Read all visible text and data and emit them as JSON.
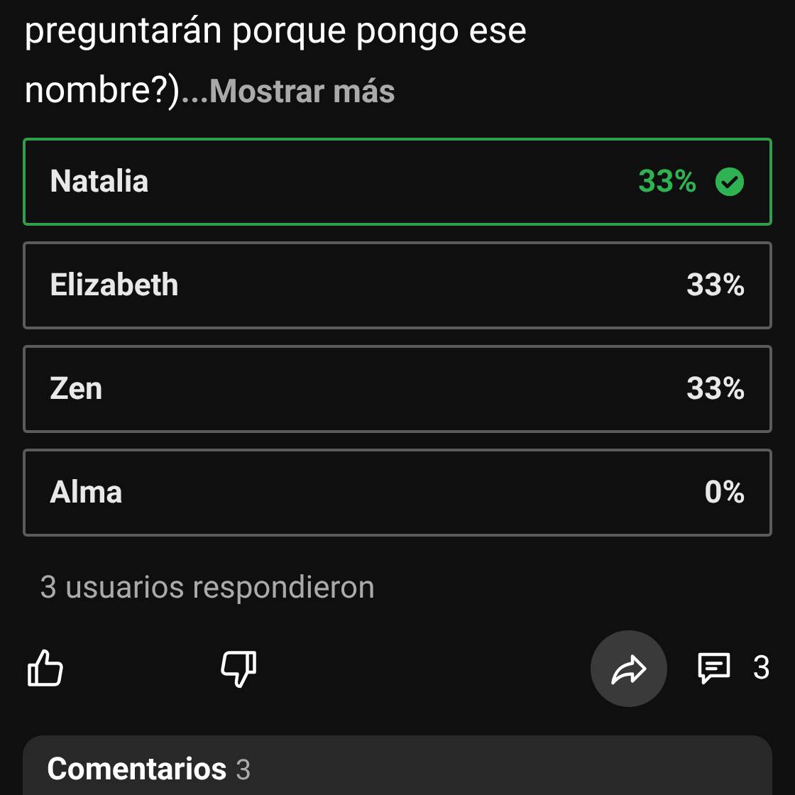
{
  "post": {
    "text_lines": [
      "preguntarán porque pongo ese",
      "nombre?)"
    ],
    "show_more": "...Mostrar más"
  },
  "poll": {
    "options": [
      {
        "label": "Natalia",
        "percent": "33%",
        "selected": true
      },
      {
        "label": "Elizabeth",
        "percent": "33%",
        "selected": false
      },
      {
        "label": "Zen",
        "percent": "33%",
        "selected": false
      },
      {
        "label": "Alma",
        "percent": "0%",
        "selected": false
      }
    ],
    "responses": "3 usuarios respondieron"
  },
  "actions": {
    "comment_count": "3"
  },
  "comments": {
    "title": "Comentarios",
    "count": "3"
  }
}
